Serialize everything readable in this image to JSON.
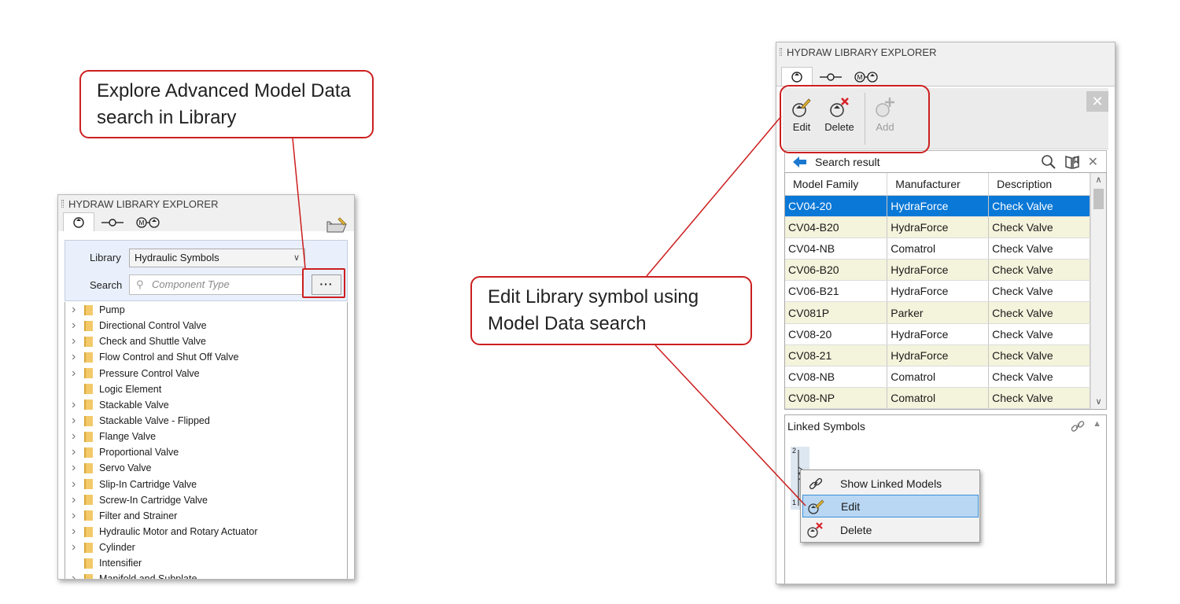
{
  "callouts": {
    "left": "Explore Advanced Model Data search in Library",
    "right": "Edit Library symbol using Model Data search"
  },
  "left_panel": {
    "title": "HYDRAW LIBRARY EXPLORER",
    "tabs": [
      "symbol-tab",
      "connector-tab",
      "motor-pump-tab"
    ],
    "library_label": "Library",
    "library_value": "Hydraulic Symbols",
    "search_label": "Search",
    "search_placeholder": "Component Type",
    "advanced_button": "···",
    "tree": [
      {
        "label": "Pump",
        "expandable": true
      },
      {
        "label": "Directional Control Valve",
        "expandable": true
      },
      {
        "label": "Check and Shuttle Valve",
        "expandable": true
      },
      {
        "label": "Flow Control and Shut Off Valve",
        "expandable": true
      },
      {
        "label": "Pressure Control Valve",
        "expandable": true
      },
      {
        "label": "Logic Element",
        "expandable": false
      },
      {
        "label": "Stackable Valve",
        "expandable": true
      },
      {
        "label": "Stackable Valve - Flipped",
        "expandable": true
      },
      {
        "label": "Flange Valve",
        "expandable": true
      },
      {
        "label": "Proportional Valve",
        "expandable": true
      },
      {
        "label": "Servo Valve",
        "expandable": true
      },
      {
        "label": "Slip-In Cartridge Valve",
        "expandable": true
      },
      {
        "label": "Screw-In Cartridge Valve",
        "expandable": true
      },
      {
        "label": "Filter and Strainer",
        "expandable": true
      },
      {
        "label": "Hydraulic Motor and Rotary Actuator",
        "expandable": true
      },
      {
        "label": "Cylinder",
        "expandable": true
      },
      {
        "label": "Intensifier",
        "expandable": false
      },
      {
        "label": "Manifold and Subplate",
        "expandable": true
      }
    ]
  },
  "right_panel": {
    "title": "HYDRAW LIBRARY EXPLORER",
    "ribbon": {
      "edit": "Edit",
      "delete": "Delete",
      "add": "Add",
      "close": "✕"
    },
    "result_title": "Search result",
    "columns": [
      "Model Family",
      "Manufacturer",
      "Description"
    ],
    "rows": [
      [
        "CV04-20",
        "HydraForce",
        "Check Valve"
      ],
      [
        "CV04-B20",
        "HydraForce",
        "Check Valve"
      ],
      [
        "CV04-NB",
        "Comatrol",
        "Check Valve"
      ],
      [
        "CV06-B20",
        "HydraForce",
        "Check Valve"
      ],
      [
        "CV06-B21",
        "HydraForce",
        "Check Valve"
      ],
      [
        "CV081P",
        "Parker",
        "Check Valve"
      ],
      [
        "CV08-20",
        "HydraForce",
        "Check Valve"
      ],
      [
        "CV08-21",
        "HydraForce",
        "Check Valve"
      ],
      [
        "CV08-NB",
        "Comatrol",
        "Check Valve"
      ],
      [
        "CV08-NP",
        "Comatrol",
        "Check Valve"
      ]
    ],
    "selected_row": 0,
    "linked_title": "Linked Symbols",
    "symbol_ports": {
      "top": "2",
      "bottom": "1"
    },
    "context_menu": [
      {
        "label": "Show Linked Models",
        "icon": "link-icon"
      },
      {
        "label": "Edit",
        "icon": "edit-icon"
      },
      {
        "label": "Delete",
        "icon": "delete-icon"
      }
    ]
  },
  "colors": {
    "callout_red": "#cc1f1f",
    "selection_blue": "#0a78d7",
    "row_alt": "#f4f3dc"
  }
}
